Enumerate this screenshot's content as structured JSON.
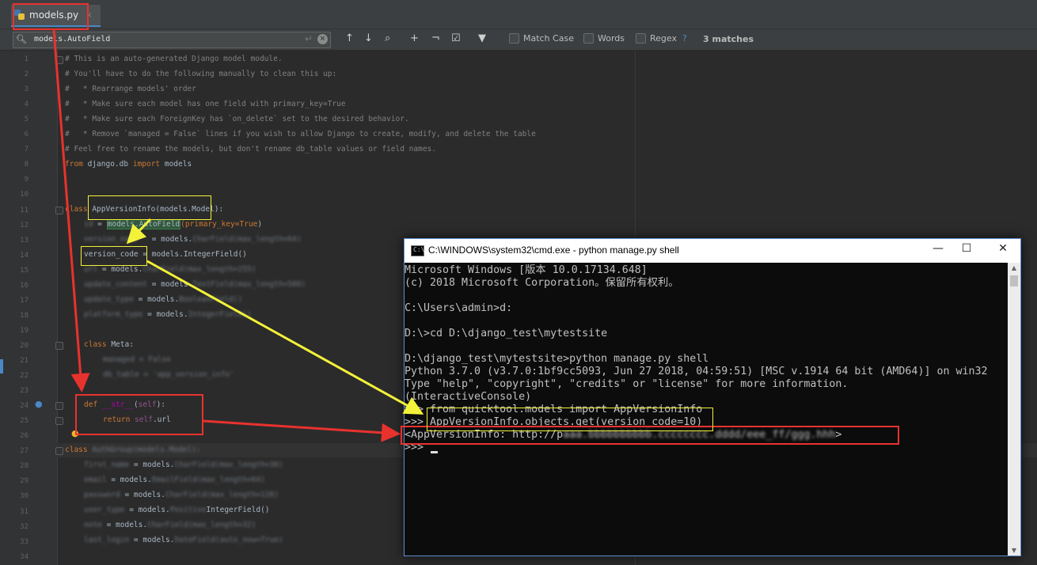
{
  "editor": {
    "tab": {
      "label": "models.py",
      "close": "×"
    },
    "find": {
      "query": "models.AutoField",
      "match_case": "Match Case",
      "words": "Words",
      "regex": "Regex",
      "help": "?",
      "matches": "3 matches"
    },
    "line_numbers": [
      "1",
      "2",
      "3",
      "4",
      "5",
      "6",
      "7",
      "8",
      "9",
      "10",
      "11",
      "12",
      "13",
      "14",
      "15",
      "16",
      "17",
      "18",
      "19",
      "20",
      "21",
      "22",
      "23",
      "24",
      "25",
      "26",
      "27",
      "28",
      "29",
      "30",
      "31",
      "32",
      "33",
      "34"
    ],
    "code": {
      "l1": "# This is an auto-generated Django model module.",
      "l2": "# You'll have to do the following manually to clean this up:",
      "l3": "#   * Rearrange models' order",
      "l4": "#   * Make sure each model has one field with primary_key=True",
      "l5": "#   * Make sure each ForeignKey has `on_delete` set to the desired behavior.",
      "l6": "#   * Remove `managed = False` lines if you wish to allow Django to create, modify, and delete the table",
      "l7": "# Feel free to rename the models, but don't rename db_table values or field names.",
      "l8_kw1": "from",
      "l8_mid": " django.db ",
      "l8_kw2": "import",
      "l8_end": " models",
      "l11_kw": "class",
      "l11_name": " AppVersionInfo(models.Model):",
      "l12_eq": " = ",
      "l12_hl": "models.AutoField",
      "l12_arg": "(primary_key=",
      "l12_true": "True",
      "l12_close": ")",
      "l13_mid": "= models.",
      "l14": "version_code = models.IntegerField()",
      "l15_mid": " = models.",
      "l16_mid": " = models.",
      "l17_mid": " = models.",
      "l18_mid": " = models.",
      "l20_kw": "class",
      "l20_name": " Meta:",
      "l24_kw": "def",
      "l24_name": " __str__",
      "l24_open": "(",
      "l24_self": "self",
      "l24_close": "):",
      "l25_kw": "return",
      "l25_self": " self",
      "l25_end": ".url",
      "l27_kw": "class",
      "l28_mid": " = models.",
      "l29_mid": " = models.",
      "l30_mid": " = models.",
      "l31_mid": " = models.",
      "l31_end": "IntegerField()",
      "l32_mid": " = models.",
      "l33_mid": " = models."
    }
  },
  "cmd": {
    "title": "C:\\WINDOWS\\system32\\cmd.exe - python  manage.py shell",
    "minimize": "—",
    "maximize": "☐",
    "close": "✕",
    "lines": [
      "Microsoft Windows [版本 10.0.17134.648]",
      "(c) 2018 Microsoft Corporation。保留所有权利。",
      "",
      "C:\\Users\\admin>d:",
      "",
      "D:\\>cd D:\\django_test\\mytestsite",
      "",
      "D:\\django_test\\mytestsite>python manage.py shell",
      "Python 3.7.0 (v3.7.0:1bf9cc5093, Jun 27 2018, 04:59:51) [MSC v.1914 64 bit (AMD64)] on win32",
      "Type \"help\", \"copyright\", \"credits\" or \"license\" for more information.",
      "(InteractiveConsole)",
      ">>> from quicktool.models import AppVersionInfo",
      ">>> AppVersionInfo.objects.get(version_code=10)",
      "<AppVersionInfo: http://p",
      ">>> "
    ],
    "result_end": ">"
  },
  "annotation_colors": {
    "red": "#e8322e",
    "yellow": "#f2f23a"
  }
}
